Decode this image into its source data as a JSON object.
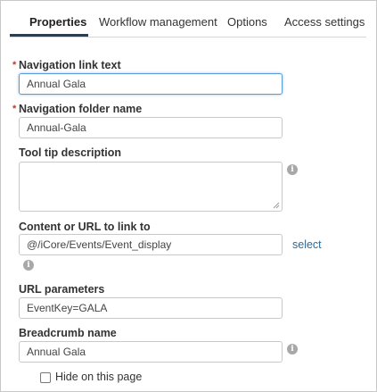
{
  "tabs": [
    {
      "label": "Properties",
      "active": true
    },
    {
      "label": "Workflow management",
      "active": false
    },
    {
      "label": "Options",
      "active": false
    },
    {
      "label": "Access settings",
      "active": false
    }
  ],
  "form": {
    "nav_link_text": {
      "label": "Navigation link text",
      "required_mark": "*",
      "value": "Annual Gala"
    },
    "nav_folder_name": {
      "label": "Navigation folder name",
      "required_mark": "*",
      "value": "Annual-Gala"
    },
    "tooltip": {
      "label": "Tool tip description",
      "value": ""
    },
    "content_url": {
      "label": "Content or URL to link to",
      "value": "@/iCore/Events/Event_display",
      "select_label": "select"
    },
    "url_params": {
      "label": "URL parameters",
      "value": "EventKey=GALA"
    },
    "breadcrumb": {
      "label": "Breadcrumb name",
      "value": "Annual Gala"
    },
    "hide_on_page": {
      "label": "Hide on this page",
      "checked": false
    }
  },
  "icons": {
    "info": "info-icon",
    "info_glyph": "i"
  },
  "colors": {
    "accent_underline": "#2c3e50",
    "link": "#2b6a9b",
    "required": "#c0392b",
    "focus_border": "#5b9bd5"
  }
}
